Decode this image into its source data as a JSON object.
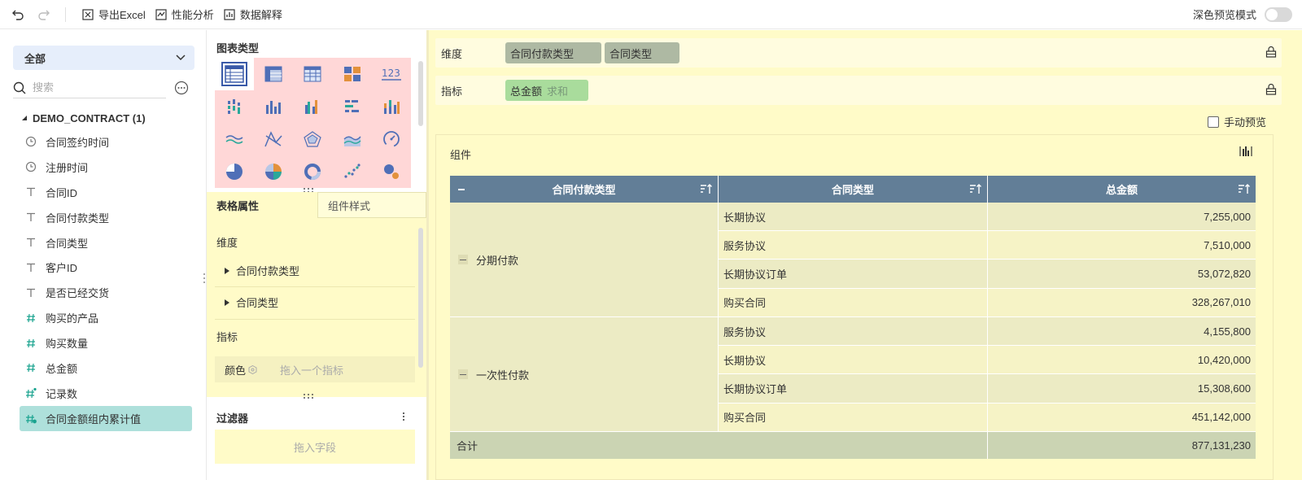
{
  "toolbar": {
    "export_excel": "导出Excel",
    "perf_analysis": "性能分析",
    "data_explain": "数据解释",
    "dark_preview": "深色预览模式"
  },
  "left": {
    "datasource": "全部",
    "search_placeholder": "搜索",
    "table_name": "DEMO_CONTRACT (1)",
    "fields": [
      {
        "label": "合同签约时间",
        "icon": "clock-icon"
      },
      {
        "label": "注册时间",
        "icon": "clock-icon"
      },
      {
        "label": "合同ID",
        "icon": "text-type-icon"
      },
      {
        "label": "合同付款类型",
        "icon": "text-type-icon"
      },
      {
        "label": "合同类型",
        "icon": "text-type-icon"
      },
      {
        "label": "客户ID",
        "icon": "text-type-icon"
      },
      {
        "label": "是否已经交货",
        "icon": "text-type-icon"
      },
      {
        "label": "购买的产品",
        "icon": "number-type-icon"
      },
      {
        "label": "购买数量",
        "icon": "number-type-icon"
      },
      {
        "label": "总金额",
        "icon": "number-type-icon"
      },
      {
        "label": "记录数",
        "icon": "calc-number-icon"
      },
      {
        "label": "合同金额组内累计值",
        "icon": "calc-number-icon"
      }
    ]
  },
  "middle": {
    "chart_type_title": "图表类型",
    "chart_types": [
      "grouped-table-icon",
      "cross-table-icon",
      "detail-table-icon",
      "kpi-card-icon",
      "number-card-icon",
      "multi-series-bar-icon",
      "column-chart-icon",
      "grouped-column-icon",
      "horizontal-bar-icon",
      "stacked-column-icon",
      "line-chart-icon",
      "scatter-line-icon",
      "radar-chart-icon",
      "area-chart-icon",
      "gauge-icon",
      "pie-chart-icon",
      "rose-chart-icon",
      "donut-chart-icon",
      "scatter-chart-icon",
      "bubble-chart-icon"
    ],
    "tab_table_props": "表格属性",
    "tab_component_style": "组件样式",
    "dimension_label": "维度",
    "dimension_items": [
      "合同付款类型",
      "合同类型"
    ],
    "measure_label": "指标",
    "color_label": "颜色",
    "color_placeholder": "拖入一个指标",
    "filter_title": "过滤器",
    "filter_placeholder": "拖入字段"
  },
  "right": {
    "dimension_label": "维度",
    "dimension_pills": [
      "合同付款类型",
      "合同类型"
    ],
    "measure_label": "指标",
    "measure_pill": "总金额",
    "measure_agg": "求和",
    "manual_preview": "手动预览",
    "component_title": "组件"
  },
  "table": {
    "headers": [
      "合同付款类型",
      "合同类型",
      "总金额"
    ],
    "groups": [
      {
        "name": "分期付款",
        "rows": [
          {
            "type": "长期协议",
            "amount": "7,255,000"
          },
          {
            "type": "服务协议",
            "amount": "7,510,000"
          },
          {
            "type": "长期协议订单",
            "amount": "53,072,820"
          },
          {
            "type": "购买合同",
            "amount": "328,267,010"
          }
        ]
      },
      {
        "name": "一次性付款",
        "rows": [
          {
            "type": "服务协议",
            "amount": "4,155,800"
          },
          {
            "type": "长期协议",
            "amount": "10,420,000"
          },
          {
            "type": "长期协议订单",
            "amount": "15,308,600"
          },
          {
            "type": "购买合同",
            "amount": "451,142,000"
          }
        ]
      }
    ],
    "total_label": "合计",
    "total_value": "877,131,230"
  },
  "colors": {
    "header_bg": "#627e97",
    "dimension_pill": "#aeb9a3",
    "measure_pill": "#a9dc9c",
    "panel_yellow": "#fffbc8",
    "chart_palette_bg": "#ffd7d7",
    "selected_field": "#aee0db"
  }
}
